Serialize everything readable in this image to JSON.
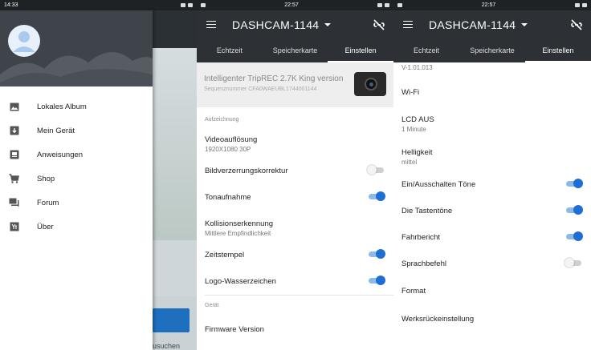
{
  "panel1": {
    "status_time": "14:33",
    "background_button_text": "usuchen",
    "menu": [
      {
        "label": "Lokales Album",
        "icon": "image-icon"
      },
      {
        "label": "Mein Gerät",
        "icon": "device-icon"
      },
      {
        "label": "Anweisungen",
        "icon": "instructions-icon"
      },
      {
        "label": "Shop",
        "icon": "cart-icon"
      },
      {
        "label": "Forum",
        "icon": "forum-icon"
      },
      {
        "label": "Über",
        "icon": "info-icon"
      }
    ]
  },
  "panel2": {
    "status_time": "22:57",
    "title": "DASHCAM-1144",
    "tabs": [
      "Echtzeit",
      "Speicherkarte",
      "Einstellen"
    ],
    "device_name": "Intelligenter TripREC 2.7K King version",
    "serial": "Sequenznummer CFA0WAEUBL1744001144",
    "section_recording": "Aufzeichnung",
    "video_res_label": "Videoauflösung",
    "video_res_value": "1920X1080 30P",
    "distortion_label": "Bildverzerrungskorrektur",
    "distortion_on": false,
    "sound_label": "Tonaufnahme",
    "sound_on": true,
    "collision_label": "Kollisionserkennung",
    "collision_value": "Mittlere Empfindlichkeit",
    "timestamp_label": "Zeitstempel",
    "timestamp_on": true,
    "watermark_label": "Logo-Wasserzeichen",
    "watermark_on": true,
    "section_device": "Gerät",
    "firmware_label": "Firmware Version"
  },
  "panel3": {
    "status_time": "22:57",
    "title": "DASHCAM-1144",
    "tabs": [
      "Echtzeit",
      "Speicherkarte",
      "Einstellen"
    ],
    "firmware_value": "V-1.01.013",
    "wifi_label": "Wi-Fi",
    "lcd_label": "LCD AUS",
    "lcd_value": "1 Minute",
    "brightness_label": "Helligkeit",
    "brightness_value": "mittel",
    "onoff_tones_label": "Ein/Ausschalten Töne",
    "onoff_tones_on": true,
    "key_tones_label": "Die Tastentöne",
    "key_tones_on": true,
    "trip_report_label": "Fahrbericht",
    "trip_report_on": true,
    "voice_cmd_label": "Sprachbefehl",
    "voice_cmd_on": false,
    "format_label": "Format",
    "reset_label": "Werksrückeinstellung"
  },
  "colors": {
    "appbar": "#2d3136",
    "accent": "#1f6ed4"
  }
}
